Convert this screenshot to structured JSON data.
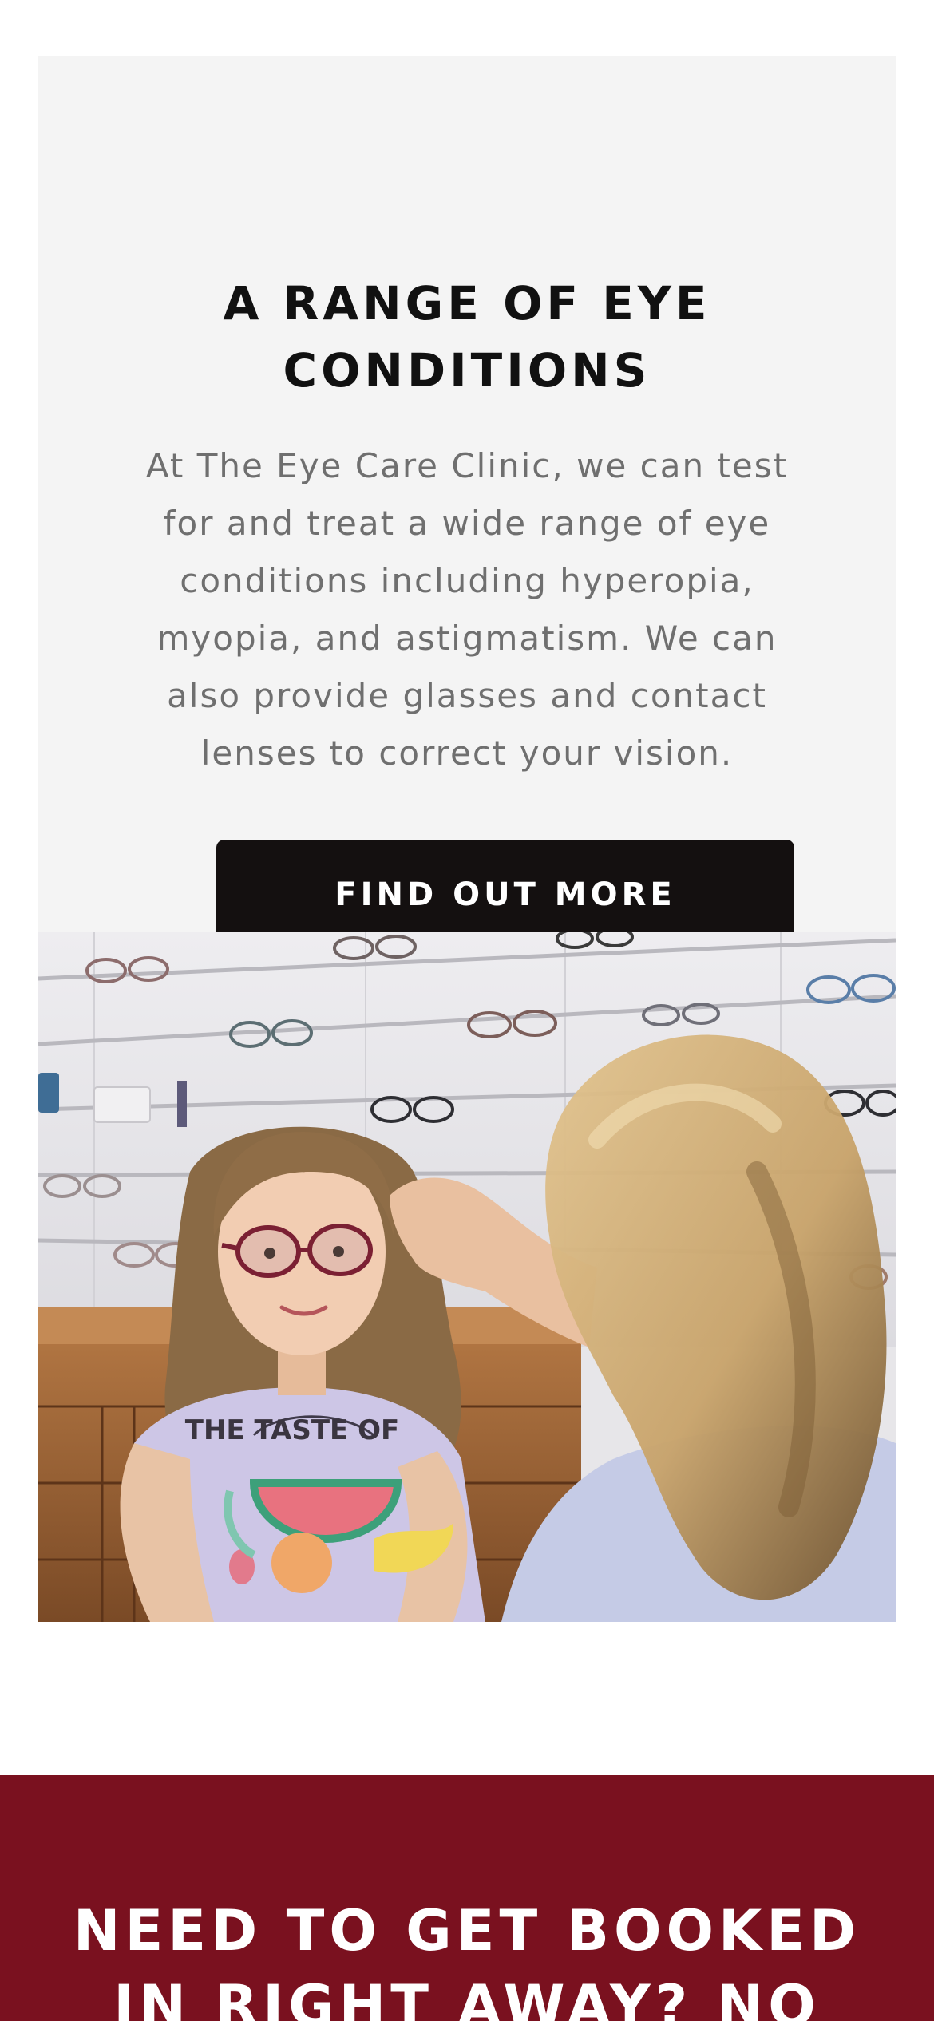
{
  "range_section": {
    "title_lines": [
      "A RANGE OF EYE",
      "CONDITIONS"
    ],
    "body_lines": [
      "At The Eye Care Clinic, we can test",
      "for and treat a wide range of eye",
      "conditions including hyperopia,",
      "myopia, and astigmatism. We can",
      "also provide glasses and contact",
      "lenses to correct your vision."
    ],
    "cta_label": "FIND OUT MORE"
  },
  "photo": {
    "tshirt_text": "THE TASTE OF"
  },
  "booking_section": {
    "title_lines": [
      "NEED TO GET BOOKED",
      "IN RIGHT AWAY? NO"
    ]
  },
  "colors": {
    "card_background": "#f4f4f4",
    "button_background": "#141010",
    "booking_background": "#7a111f",
    "heading_text": "#111111",
    "body_text": "#6f6f6f"
  }
}
